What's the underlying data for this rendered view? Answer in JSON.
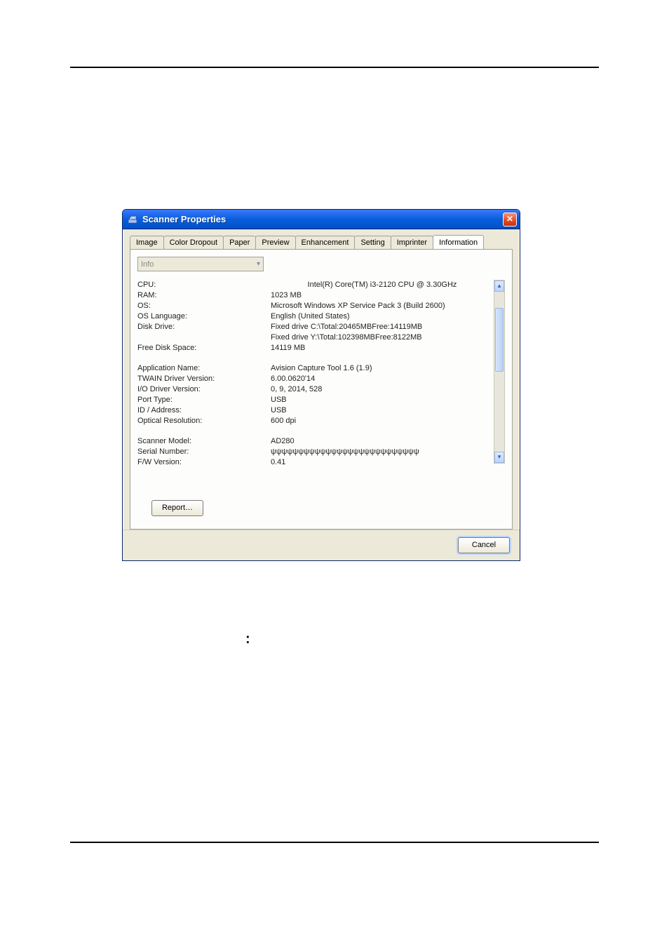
{
  "dialog": {
    "title": "Scanner Properties",
    "close_glyph": "✕"
  },
  "tabs": {
    "image": "Image",
    "color_dropout": "Color Dropout",
    "paper": "Paper",
    "preview": "Preview",
    "enhancement": "Enhancement",
    "setting": "Setting",
    "imprinter": "Imprinter",
    "information": "Information"
  },
  "info_select": {
    "label": "Info",
    "arrow": "▾"
  },
  "info": {
    "cpu": {
      "label": "CPU:",
      "value": "Intel(R) Core(TM) i3-2120 CPU @ 3.30GHz"
    },
    "ram": {
      "label": "RAM:",
      "value": "1023 MB"
    },
    "os": {
      "label": "OS:",
      "value": "Microsoft Windows XP Service Pack 3 (Build 2600)"
    },
    "os_lang": {
      "label": "OS Language:",
      "value": "English (United States)"
    },
    "disk_drive": {
      "label": "Disk Drive:",
      "value": "Fixed drive C:\\Total:20465MBFree:14119MB"
    },
    "disk_drive2": {
      "label": "",
      "value": "Fixed drive Y:\\Total:102398MBFree:8122MB"
    },
    "free_space": {
      "label": "Free Disk Space:",
      "value": "14119 MB"
    },
    "app_name": {
      "label": "Application Name:",
      "value": "Avision Capture Tool 1.6 (1.9)"
    },
    "twain": {
      "label": "TWAIN Driver Version:",
      "value": "6.00.0620'14"
    },
    "io_driver": {
      "label": "I/O Driver Version:",
      "value": "0, 9, 2014, 528"
    },
    "port_type": {
      "label": "Port Type:",
      "value": "USB"
    },
    "id_addr": {
      "label": "ID / Address:",
      "value": "USB"
    },
    "opt_res": {
      "label": "Optical Resolution:",
      "value": "600 dpi"
    },
    "model": {
      "label": "Scanner Model:",
      "value": "AD280"
    },
    "serial": {
      "label": "Serial Number:",
      "value": "ψψψψψψψψψψψψψψψψψψψψψψψψψψψ"
    },
    "fw": {
      "label": "F/W Version:",
      "value": "0.41"
    }
  },
  "buttons": {
    "report": "Report…",
    "cancel": "Cancel"
  },
  "page": {
    "colon": ":"
  }
}
